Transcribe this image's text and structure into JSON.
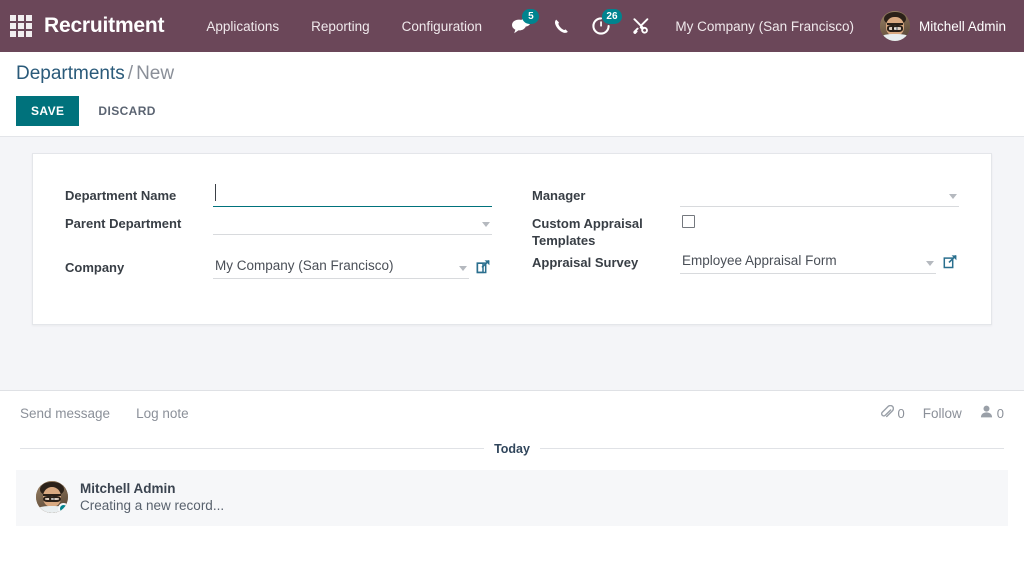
{
  "navbar": {
    "apps_icon": "apps-grid-icon",
    "brand": "Recruitment",
    "menu": [
      {
        "label": "Applications"
      },
      {
        "label": "Reporting"
      },
      {
        "label": "Configuration"
      }
    ],
    "systray": [
      {
        "icon": "messages-icon",
        "badge": "5"
      },
      {
        "icon": "phone-icon",
        "badge": ""
      },
      {
        "icon": "activity-clock-icon",
        "badge": "26"
      },
      {
        "icon": "tools-wrench-icon",
        "badge": ""
      }
    ],
    "company": "My Company (San Francisco)",
    "user": "Mitchell Admin",
    "avatar_icon": "user-avatar"
  },
  "control_panel": {
    "breadcrumb_root": "Departments",
    "breadcrumb_separator": "/",
    "breadcrumb_current": "New",
    "save_label": "SAVE",
    "discard_label": "DISCARD"
  },
  "form": {
    "left": {
      "department_name": {
        "label": "Department Name",
        "value": "",
        "placeholder": "",
        "focused": true
      },
      "parent_department": {
        "label": "Parent Department",
        "value": "",
        "placeholder": ""
      },
      "company": {
        "label": "Company",
        "value": "My Company (San Francisco)",
        "ext_link_icon": "external-link-icon"
      }
    },
    "right": {
      "manager": {
        "label": "Manager",
        "value": "",
        "placeholder": ""
      },
      "custom_appraisal_templates": {
        "label": "Custom Appraisal Templates",
        "checked": false
      },
      "appraisal_survey": {
        "label": "Appraisal Survey",
        "value": "Employee Appraisal Form",
        "ext_link_icon": "external-link-icon"
      }
    }
  },
  "chatter": {
    "send_message": "Send message",
    "log_note": "Log note",
    "attachment_icon": "paperclip-icon",
    "attachment_count": "0",
    "follow_label": "Follow",
    "follower_icon": "user-follower-icon",
    "follower_count": "0",
    "date_separator": "Today",
    "messages": [
      {
        "author": "Mitchell Admin",
        "body": "Creating a new record...",
        "avatar_icon": "user-avatar",
        "online": true
      }
    ]
  },
  "colors": {
    "navbar_bg": "#6b4759",
    "accent_teal": "#00727c",
    "badge_teal": "#00848f",
    "page_bg": "#f4f5f8",
    "breadcrumb_link": "#2a5a7a"
  }
}
